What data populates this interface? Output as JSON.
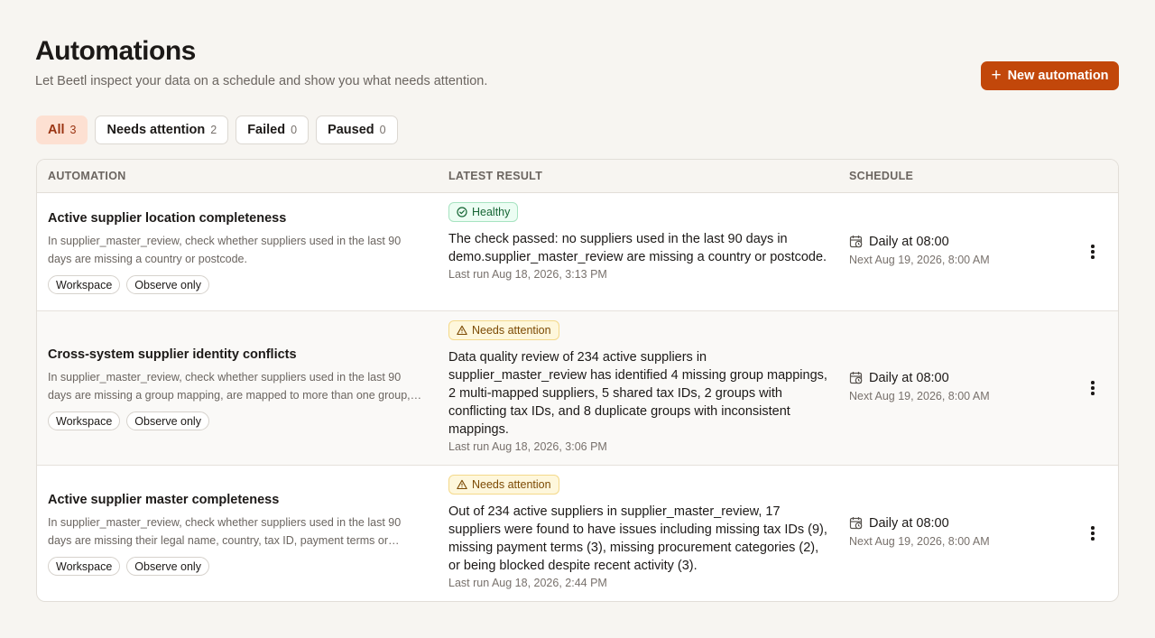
{
  "header": {
    "title": "Automations",
    "subtitle": "Let Beetl inspect your data on a schedule and show you what needs attention.",
    "new_button_label": "New automation"
  },
  "filters": [
    {
      "label": "All",
      "count": "3",
      "active": true
    },
    {
      "label": "Needs attention",
      "count": "2"
    },
    {
      "label": "Failed",
      "count": "0"
    },
    {
      "label": "Paused",
      "count": "0"
    }
  ],
  "table": {
    "columns": {
      "automation": "AUTOMATION",
      "latest_result": "LATEST RESULT",
      "schedule": "SCHEDULE"
    },
    "rows": [
      {
        "name": "Active supplier location completeness",
        "description": "In supplier_master_review, check whether suppliers used in the last 90 days are missing a country or postcode.",
        "tags": [
          "Workspace",
          "Observe only"
        ],
        "status": "Healthy",
        "status_kind": "healthy",
        "result": "The check passed: no suppliers used in the last 90 days in demo.supplier_master_review are missing a country or postcode.",
        "last_run": "Last run Aug 18, 2026, 3:13 PM",
        "schedule": "Daily at 08:00",
        "next_run": "Next Aug 19, 2026, 8:00 AM"
      },
      {
        "name": "Cross-system supplier identity conflicts",
        "description": "In supplier_master_review, check whether suppliers used in the last 90 days are missing a group mapping, are mapped to more than one group, share a tax ID, or have conflicting tax IDs.",
        "tags": [
          "Workspace",
          "Observe only"
        ],
        "status": "Needs attention",
        "status_kind": "warn",
        "result": "Data quality review of 234 active suppliers in supplier_master_review has identified 4 missing group mappings, 2 multi-mapped suppliers, 5 shared tax IDs, 2 groups with conflicting tax IDs, and 8 duplicate groups with inconsistent mappings.",
        "last_run": "Last run Aug 18, 2026, 3:06 PM",
        "schedule": "Daily at 08:00",
        "next_run": "Next Aug 19, 2026, 8:00 AM"
      },
      {
        "name": "Active supplier master completeness",
        "description": "In supplier_master_review, check whether suppliers used in the last 90 days are missing their legal name, country, tax ID, payment terms or procurement category.",
        "tags": [
          "Workspace",
          "Observe only"
        ],
        "status": "Needs attention",
        "status_kind": "warn",
        "result": "Out of 234 active suppliers in supplier_master_review, 17 suppliers were found to have issues including missing tax IDs (9), missing payment terms (3), missing procurement categories (2), or being blocked despite recent activity (3).",
        "last_run": "Last run Aug 18, 2026, 2:44 PM",
        "schedule": "Daily at 08:00",
        "next_run": "Next Aug 19, 2026, 8:00 AM"
      }
    ]
  },
  "icons": {
    "plus": "plus-icon",
    "healthy": "check-circle-icon",
    "warn": "warning-triangle-icon",
    "schedule": "calendar-clock-icon",
    "menu": "more-vertical-icon"
  },
  "colors": {
    "accent": "#c2470a",
    "background": "#f7f5f1",
    "healthy": "#166534",
    "warning": "#7c4a03"
  }
}
